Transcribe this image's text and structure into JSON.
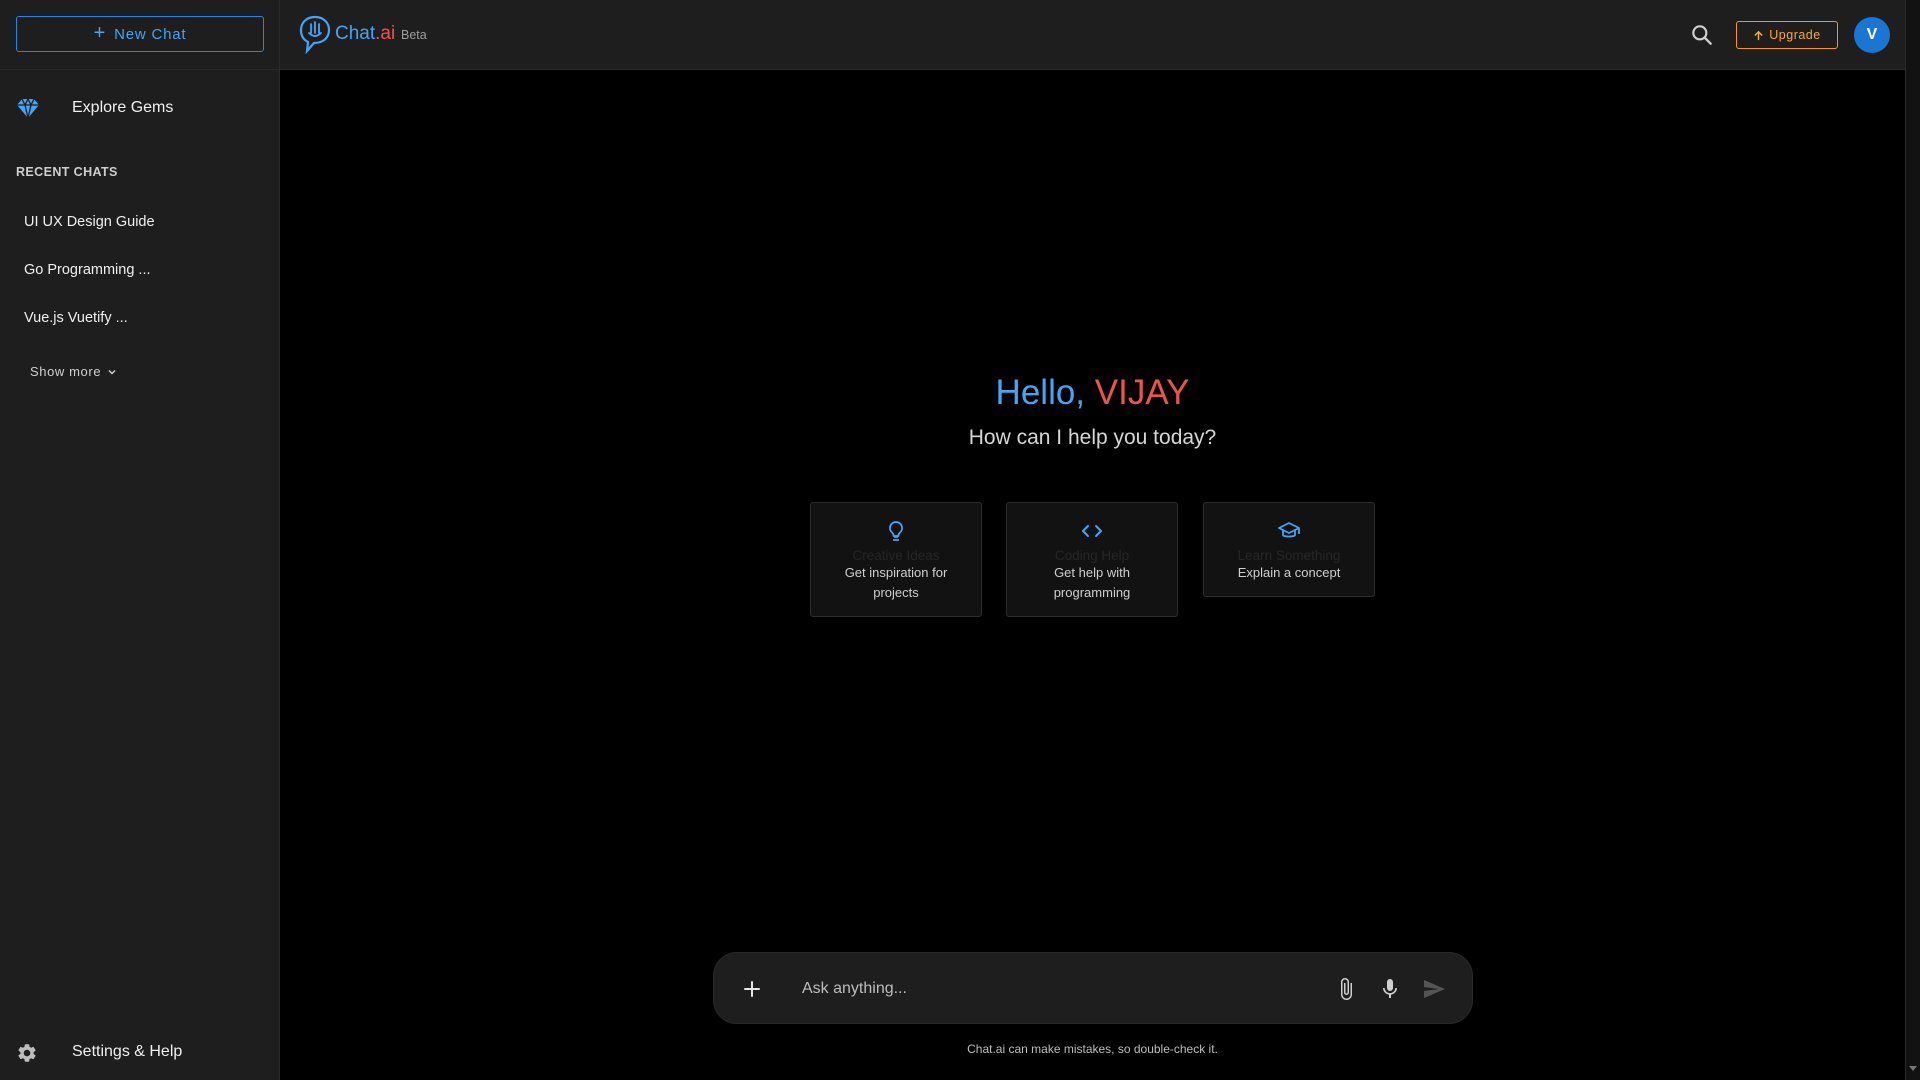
{
  "sidebar": {
    "new_chat_label": "New Chat",
    "explore_gems_label": "Explore Gems",
    "recent_title": "RECENT CHATS",
    "recent_chats": [
      "UI UX Design Guide",
      "Go Programming ...",
      "Vue.js Vuetify ..."
    ],
    "show_more_label": "Show more",
    "settings_label": "Settings & Help"
  },
  "header": {
    "brand_part1": "Chat",
    "brand_part2": ".ai",
    "beta_label": "Beta",
    "upgrade_label": "Upgrade",
    "avatar_initial": "V"
  },
  "main": {
    "greeting_hello": "Hello,",
    "greeting_name": "VIJAY",
    "subtitle": "How can I help you today?",
    "cards": [
      {
        "title": "Creative Ideas",
        "description": "Get inspiration for projects",
        "icon": "lightbulb-icon"
      },
      {
        "title": "Coding Help",
        "description": "Get help with programming",
        "icon": "code-icon"
      },
      {
        "title": "Learn Something",
        "description": "Explain a concept",
        "icon": "graduation-cap-icon"
      }
    ]
  },
  "composer": {
    "placeholder": "Ask anything...",
    "disclaimer": "Chat.ai can make mistakes, so double-check it."
  },
  "colors": {
    "accent_blue": "#42a5f5",
    "accent_red": "#ef5350",
    "upgrade_orange": "#ffa726",
    "sidebar_bg": "#1e1e1e",
    "main_bg": "#000000"
  }
}
